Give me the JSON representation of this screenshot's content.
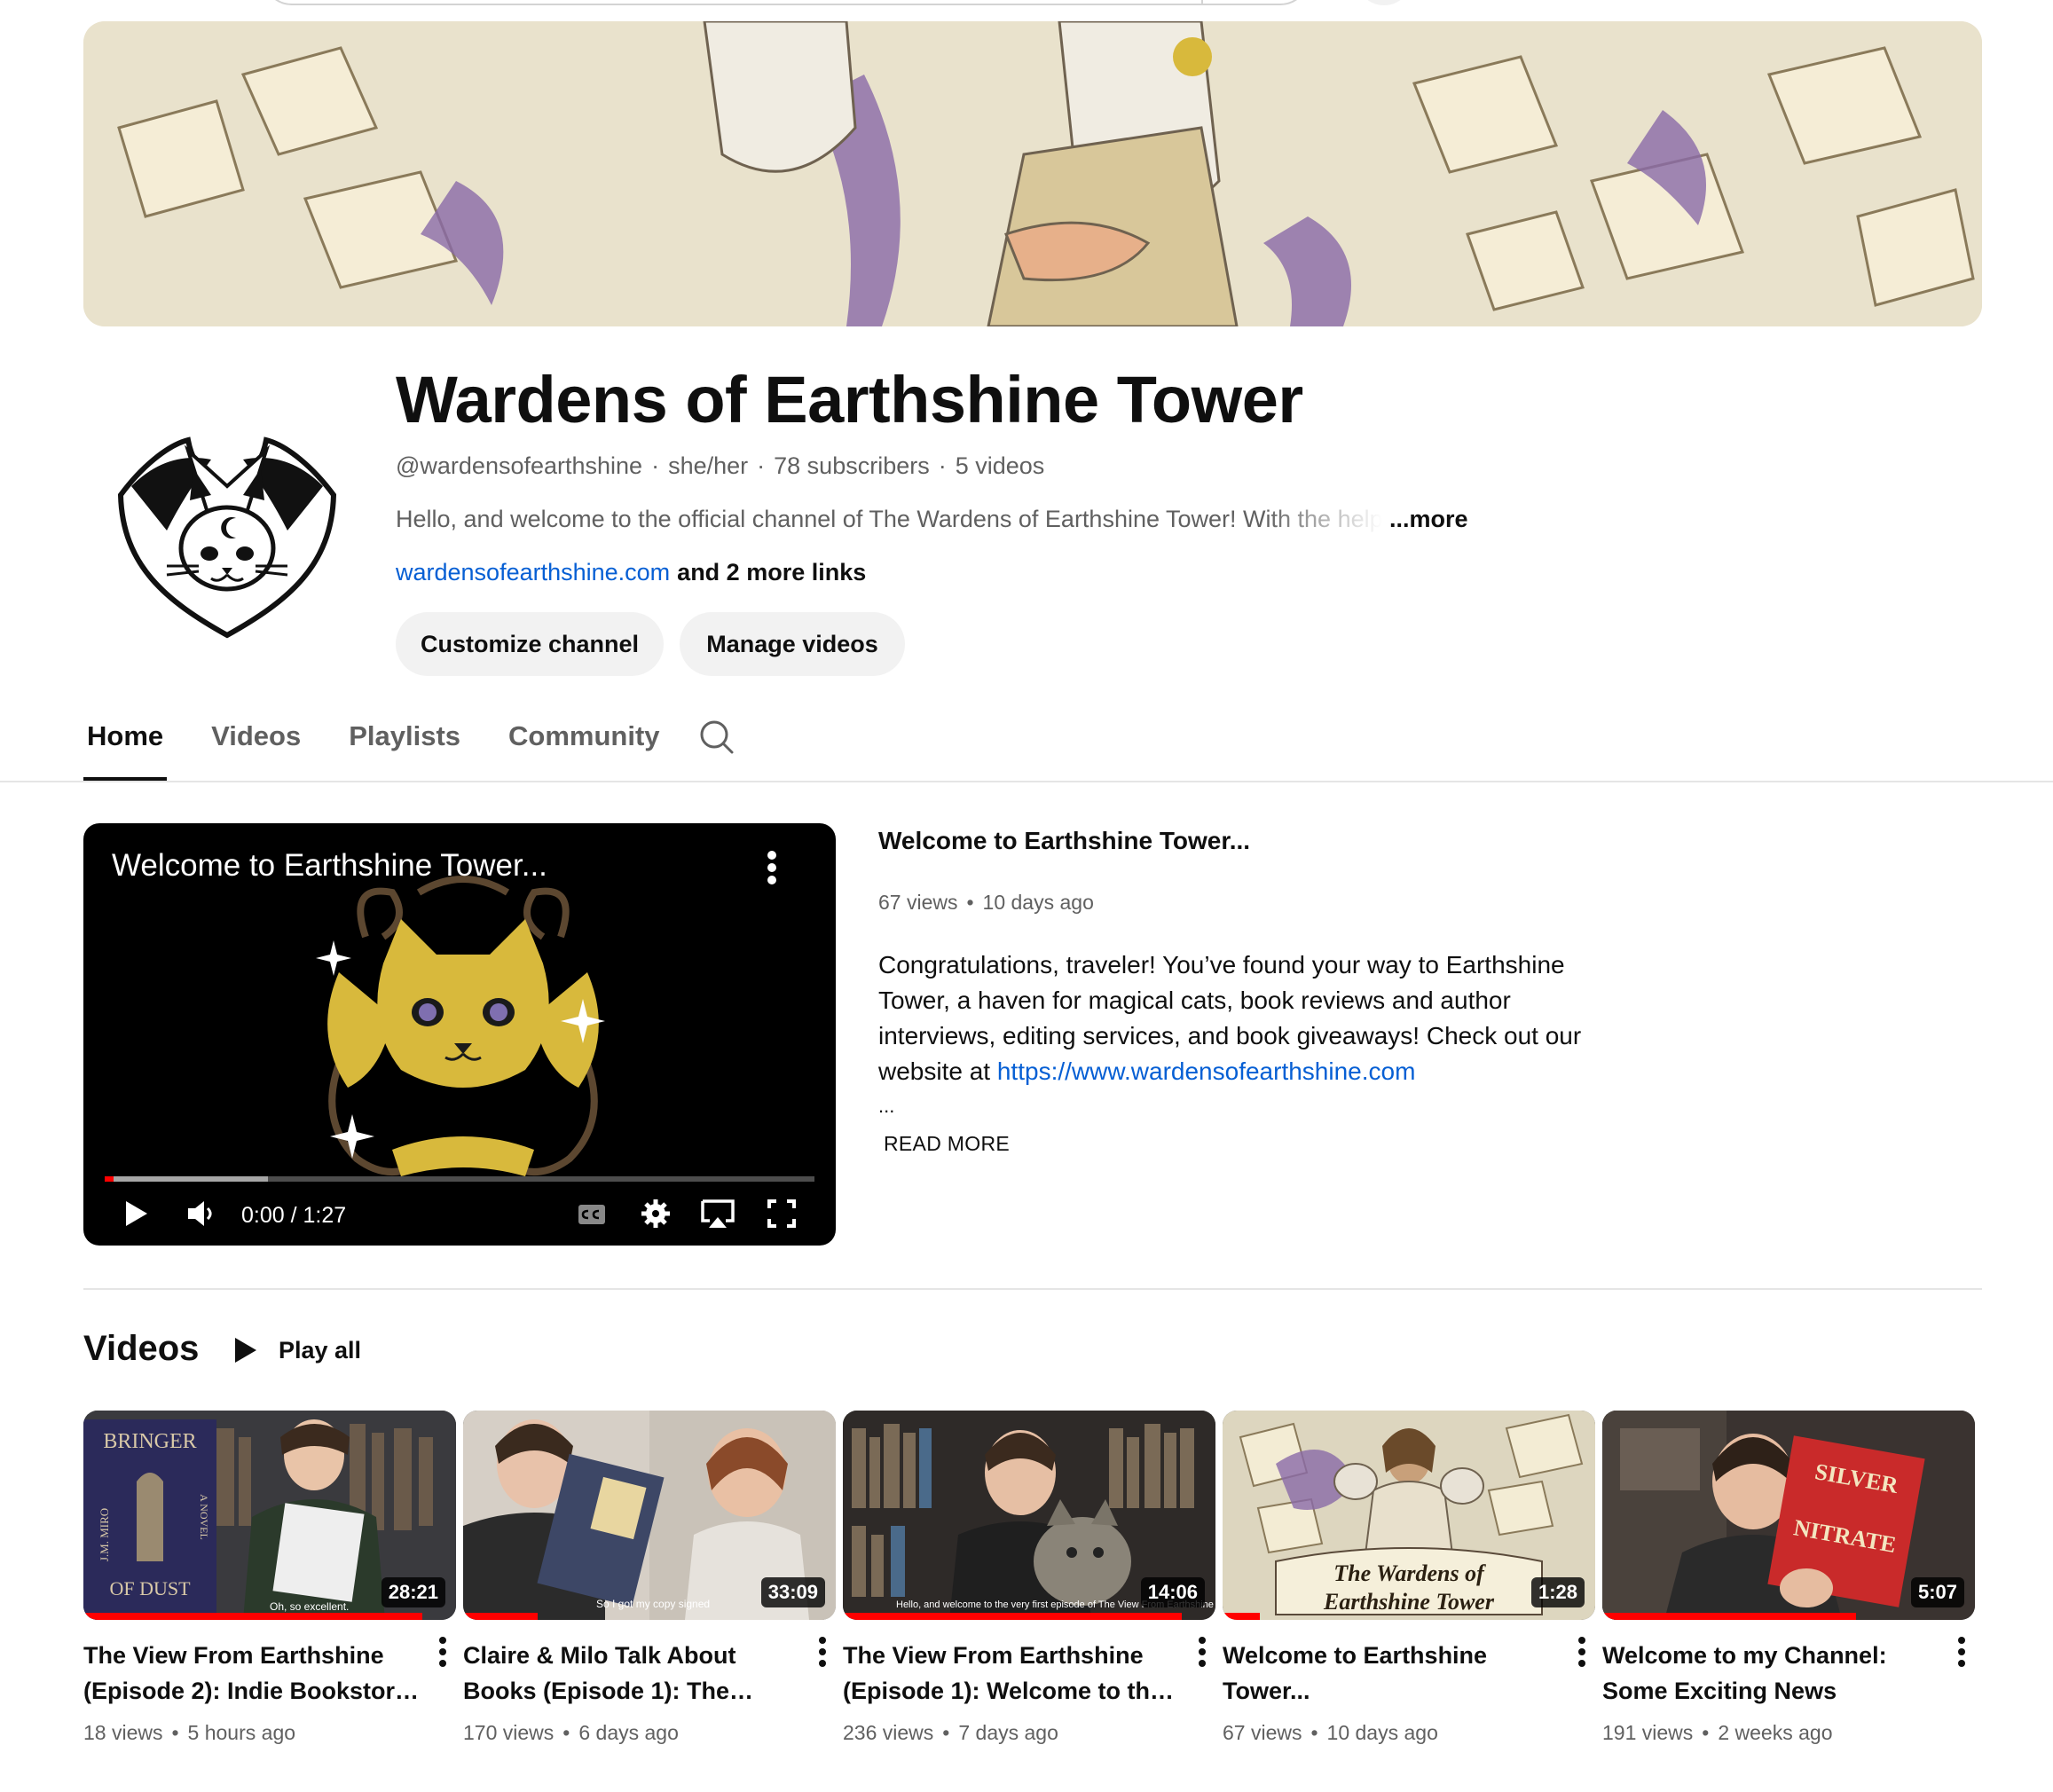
{
  "channel": {
    "name": "Wardens of Earthshine Tower",
    "handle": "@wardensofearthshine",
    "pronouns": "she/her",
    "subscribers": "78 subscribers",
    "video_count": "5 videos",
    "description": "Hello, and welcome to the official channel of The Wardens of Earthshine Tower! With the help of our magical cats",
    "more_label": "...more",
    "link_text": "wardensofearthshine.com",
    "more_links": "and 2 more links",
    "customize_label": "Customize channel",
    "manage_label": "Manage videos"
  },
  "tabs": [
    "Home",
    "Videos",
    "Playlists",
    "Community"
  ],
  "featured": {
    "overlay_title": "Welcome to Earthshine Tower...",
    "title": "Welcome to Earthshine Tower...",
    "views": "67 views",
    "age": "10 days ago",
    "description": "Congratulations, traveler! You’ve found your way to Earthshine Tower, a haven for magical cats, book reviews and author interviews, editing services, and book giveaways! Check out our website at",
    "description_link": "https://www.wardensofearthshine.com",
    "ellipsis": "...",
    "read_more": "READ MORE",
    "time": "0:00 / 1:27",
    "progress": 0.23
  },
  "shelf": {
    "title": "Videos",
    "play_all": "Play all",
    "videos": [
      {
        "title": "The View From Earthshine (Episode 2): Indie Bookstore Visit",
        "views": "18 views",
        "age": "5 hours ago",
        "duration": "28:21",
        "watched": 0.91,
        "caption": "Oh, so excellent."
      },
      {
        "title": "Claire & Milo Talk About Books (Episode 1): The Seven Husbands",
        "views": "170 views",
        "age": "6 days ago",
        "duration": "33:09",
        "watched": 0.2,
        "caption": "So I got my copy signed"
      },
      {
        "title": "The View From Earthshine (Episode 1): Welcome to the Tower",
        "views": "236 views",
        "age": "7 days ago",
        "duration": "14:06",
        "watched": 0.91,
        "caption": "Hello, and welcome to the very first episode of The View From Earthshine Tower"
      },
      {
        "title": "Welcome to Earthshine Tower...",
        "views": "67 views",
        "age": "10 days ago",
        "duration": "1:28",
        "watched": 0.1,
        "caption": ""
      },
      {
        "title": "Welcome to my Channel: Some Exciting News",
        "views": "191 views",
        "age": "2 weeks ago",
        "duration": "5:07",
        "watched": 0.68,
        "caption": ""
      }
    ]
  },
  "thumb_texts": {
    "book1_top": "BRINGER",
    "book1_bottom": "OF DUST",
    "book1_side": "J.M. MIRO",
    "book1_novel": "A NOVEL",
    "v4_line1": "The Wardens of",
    "v4_line2": "Earthshine Tower",
    "v5_book_top": "SILVER",
    "v5_book_mid": "NITRATE"
  },
  "colors": {
    "accent": "#065fd4",
    "progress": "#ff0000",
    "gold": "#d8b93c"
  }
}
